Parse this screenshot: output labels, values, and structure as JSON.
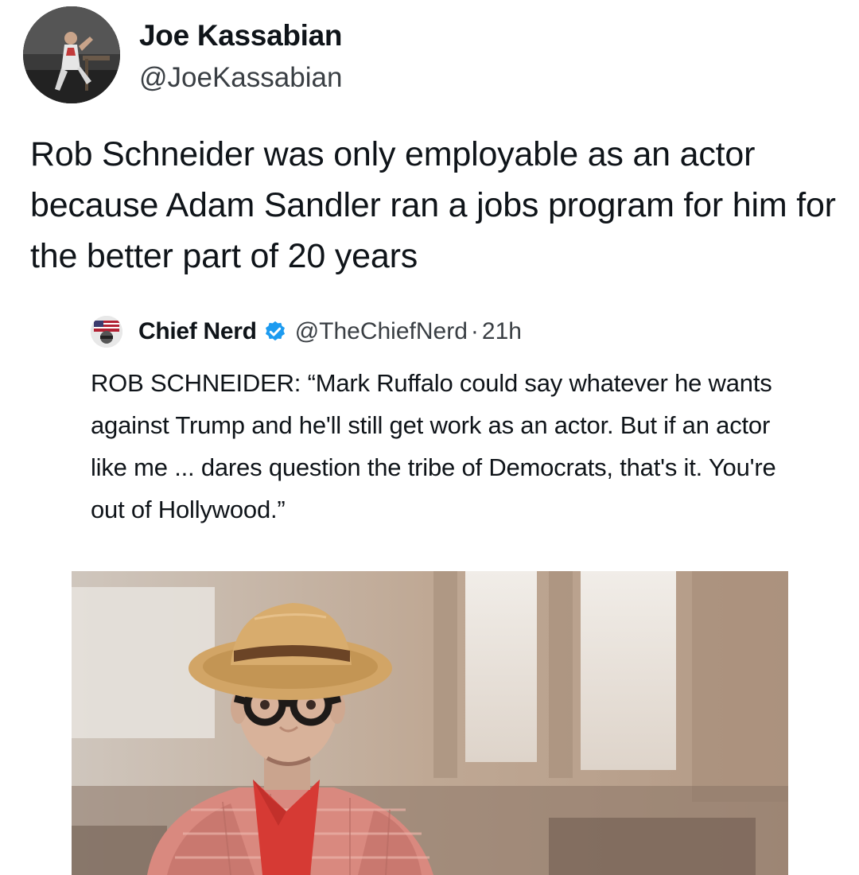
{
  "tweet": {
    "author_name": "Joe Kassabian",
    "author_handle": "@JoeKassabian",
    "text": "Rob Schneider was only employable as an actor because Adam Sandler ran a jobs program for him for the better part of 20 years"
  },
  "quoted_tweet": {
    "author_name": "Chief Nerd",
    "author_handle": "@TheChiefNerd",
    "separator": "·",
    "timestamp": "21h",
    "verified": true,
    "text": "ROB SCHNEIDER: “Mark Ruffalo could say whatever he wants against Trump and he'll still get work as an actor. But if an actor like me ... dares question the tribe of Democrats, that's it. You're out of Hollywood.”",
    "media": {
      "icon": "photo-of-man-in-hat-and-glasses"
    }
  },
  "colors": {
    "text": "#0f1419",
    "secondary_text": "#3a3f44",
    "verified_badge": "#1d9bf0",
    "background": "#ffffff"
  }
}
